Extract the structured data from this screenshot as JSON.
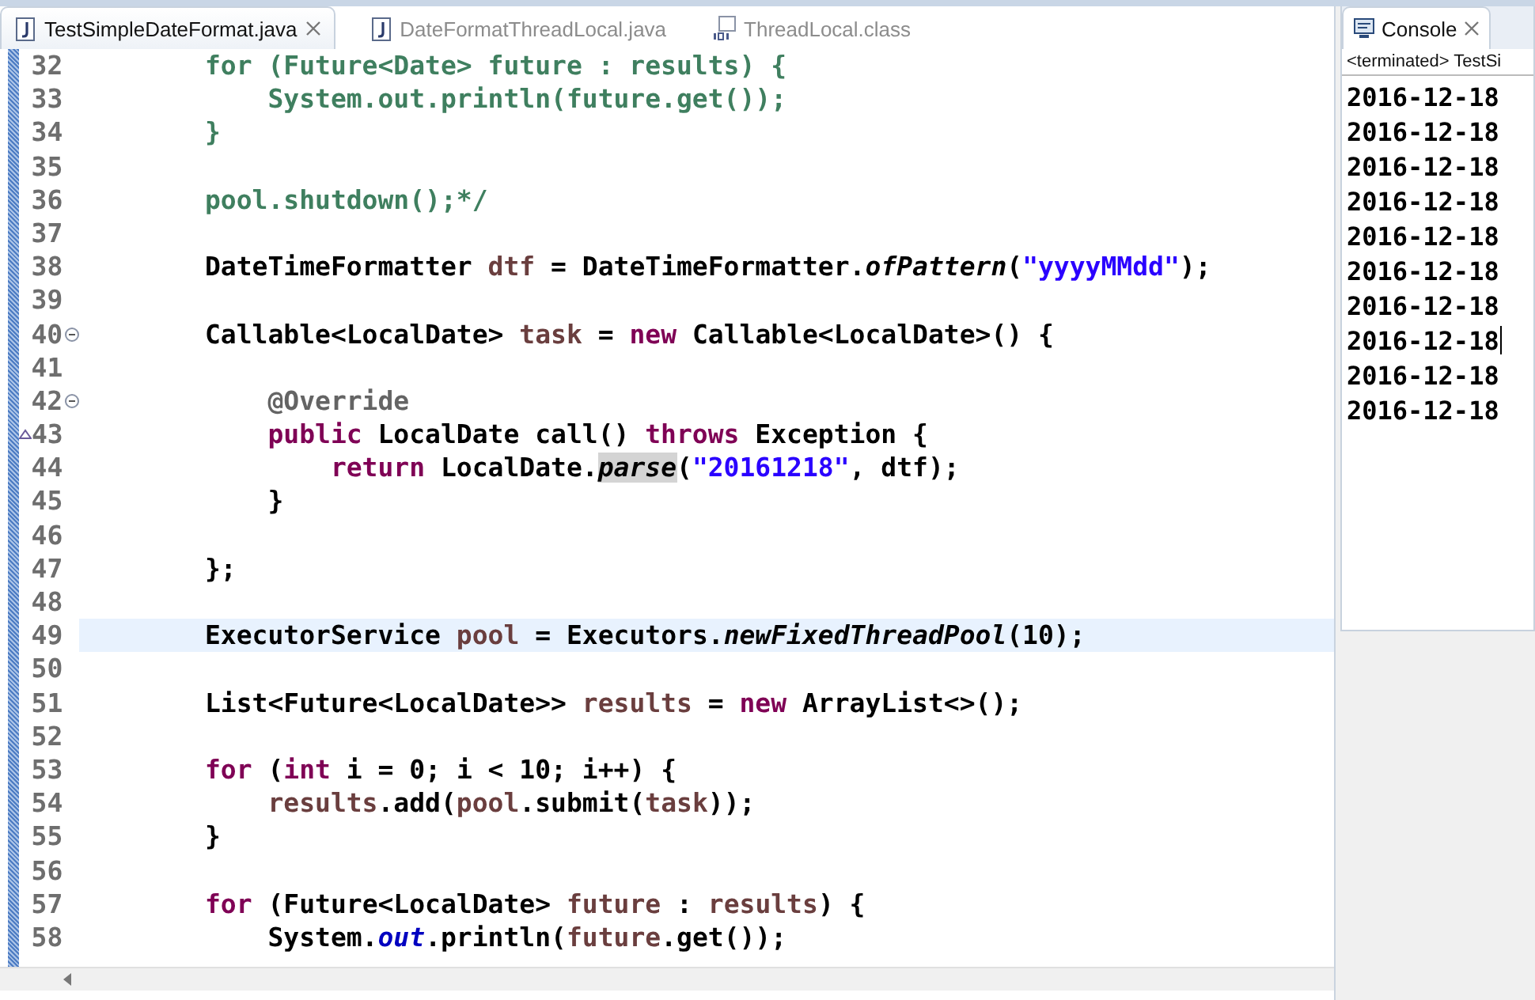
{
  "editor": {
    "tabs": [
      {
        "label": "TestSimpleDateFormat.java",
        "kind": "java",
        "selected": true,
        "closable": true
      },
      {
        "label": "DateFormatThreadLocal.java",
        "kind": "java",
        "selected": false,
        "closable": false
      },
      {
        "label": "ThreadLocal.class",
        "kind": "class",
        "selected": false,
        "closable": false
      }
    ],
    "lines": [
      {
        "num": "32",
        "kind": "code",
        "current": false,
        "tokens": [
          {
            "kind": "comment",
            "text": "        for (Future<Date> future : results) {"
          }
        ]
      },
      {
        "num": "33",
        "kind": "code",
        "current": false,
        "tokens": [
          {
            "kind": "comment",
            "text": "            System.out.println(future.get());"
          }
        ]
      },
      {
        "num": "34",
        "kind": "code",
        "current": false,
        "tokens": [
          {
            "kind": "comment",
            "text": "        }"
          }
        ]
      },
      {
        "num": "35",
        "kind": "code",
        "current": false
      },
      {
        "num": "36",
        "kind": "code",
        "current": false,
        "tokens": [
          {
            "kind": "comment",
            "text": "        pool.shutdown();*/"
          }
        ]
      },
      {
        "num": "37",
        "kind": "code",
        "current": false
      },
      {
        "num": "38",
        "kind": "code",
        "current": false,
        "tokens": [
          {
            "kind": "plain",
            "text": "        DateTimeFormatter "
          },
          {
            "kind": "variable",
            "text": "dtf"
          },
          {
            "kind": "plain",
            "text": " = DateTimeFormatter."
          },
          {
            "kind": "static",
            "text": "ofPattern"
          },
          {
            "kind": "plain",
            "text": "("
          },
          {
            "kind": "string",
            "text": "\"yyyyMMdd\""
          },
          {
            "kind": "plain",
            "text": ");"
          }
        ]
      },
      {
        "num": "39",
        "kind": "code",
        "current": false
      },
      {
        "num": "40",
        "kind": "fold",
        "current": false,
        "tokens": [
          {
            "kind": "plain",
            "text": "        Callable<LocalDate> "
          },
          {
            "kind": "variable",
            "text": "task"
          },
          {
            "kind": "plain",
            "text": " = "
          },
          {
            "kind": "keyword",
            "text": "new"
          },
          {
            "kind": "plain",
            "text": " Callable<LocalDate>() {"
          }
        ]
      },
      {
        "num": "41",
        "kind": "code",
        "current": false
      },
      {
        "num": "42",
        "kind": "fold",
        "current": false,
        "tokens": [
          {
            "kind": "annotation",
            "text": "            @Override"
          }
        ]
      },
      {
        "num": "43",
        "kind": "override",
        "current": false,
        "tokens": [
          {
            "kind": "keyword",
            "text": "            public"
          },
          {
            "kind": "plain",
            "text": " LocalDate call() "
          },
          {
            "kind": "keyword",
            "text": "throws"
          },
          {
            "kind": "plain",
            "text": " Exception {"
          }
        ]
      },
      {
        "num": "44",
        "kind": "code",
        "current": false,
        "tokens": [
          {
            "kind": "keyword",
            "text": "                return"
          },
          {
            "kind": "plain",
            "text": " LocalDate."
          },
          {
            "kind": "occurrence",
            "text": "parse"
          },
          {
            "kind": "plain",
            "text": "("
          },
          {
            "kind": "string",
            "text": "\"20161218\""
          },
          {
            "kind": "plain",
            "text": ", dtf);"
          }
        ]
      },
      {
        "num": "45",
        "kind": "code",
        "current": false,
        "tokens": [
          {
            "kind": "plain",
            "text": "            }"
          }
        ]
      },
      {
        "num": "46",
        "kind": "code",
        "current": false
      },
      {
        "num": "47",
        "kind": "code",
        "current": false,
        "tokens": [
          {
            "kind": "plain",
            "text": "        };"
          }
        ]
      },
      {
        "num": "48",
        "kind": "code",
        "current": false
      },
      {
        "num": "49",
        "kind": "code",
        "current": true,
        "tokens": [
          {
            "kind": "plain",
            "text": "        ExecutorService "
          },
          {
            "kind": "variable",
            "text": "pool"
          },
          {
            "kind": "plain",
            "text": " = Executors."
          },
          {
            "kind": "static",
            "text": "newFixedThreadPool"
          },
          {
            "kind": "plain",
            "text": "(10);"
          }
        ]
      },
      {
        "num": "50",
        "kind": "code",
        "current": false
      },
      {
        "num": "51",
        "kind": "code",
        "current": false,
        "tokens": [
          {
            "kind": "plain",
            "text": "        List<Future<LocalDate>> "
          },
          {
            "kind": "variable",
            "text": "results"
          },
          {
            "kind": "plain",
            "text": " = "
          },
          {
            "kind": "keyword",
            "text": "new"
          },
          {
            "kind": "plain",
            "text": " ArrayList<>();"
          }
        ]
      },
      {
        "num": "52",
        "kind": "code",
        "current": false
      },
      {
        "num": "53",
        "kind": "code",
        "current": false,
        "tokens": [
          {
            "kind": "keyword",
            "text": "        for"
          },
          {
            "kind": "plain",
            "text": " ("
          },
          {
            "kind": "keyword",
            "text": "int"
          },
          {
            "kind": "plain",
            "text": " i = 0; i < 10; i++) {"
          }
        ]
      },
      {
        "num": "54",
        "kind": "code",
        "current": false,
        "tokens": [
          {
            "kind": "variable",
            "text": "            results"
          },
          {
            "kind": "plain",
            "text": ".add("
          },
          {
            "kind": "variable",
            "text": "pool"
          },
          {
            "kind": "plain",
            "text": ".submit("
          },
          {
            "kind": "variable",
            "text": "task"
          },
          {
            "kind": "plain",
            "text": "));"
          }
        ]
      },
      {
        "num": "55",
        "kind": "code",
        "current": false,
        "tokens": [
          {
            "kind": "plain",
            "text": "        }"
          }
        ]
      },
      {
        "num": "56",
        "kind": "code",
        "current": false
      },
      {
        "num": "57",
        "kind": "code",
        "current": false,
        "tokens": [
          {
            "kind": "keyword",
            "text": "        for"
          },
          {
            "kind": "plain",
            "text": " (Future<LocalDate> "
          },
          {
            "kind": "variable",
            "text": "future"
          },
          {
            "kind": "plain",
            "text": " : "
          },
          {
            "kind": "variable",
            "text": "results"
          },
          {
            "kind": "plain",
            "text": ") {"
          }
        ]
      },
      {
        "num": "58",
        "kind": "code",
        "current": false,
        "tokens": [
          {
            "kind": "plain",
            "text": "            System."
          },
          {
            "kind": "field",
            "text": "out"
          },
          {
            "kind": "plain",
            "text": ".println("
          },
          {
            "kind": "variable",
            "text": "future"
          },
          {
            "kind": "plain",
            "text": ".get());"
          }
        ]
      }
    ]
  },
  "console": {
    "tab": {
      "label": "Console",
      "selected": true
    },
    "status": "<terminated> TestSi",
    "output": [
      {
        "text": "2016-12-18",
        "caret": false
      },
      {
        "text": "2016-12-18",
        "caret": false
      },
      {
        "text": "2016-12-18",
        "caret": false
      },
      {
        "text": "2016-12-18",
        "caret": false
      },
      {
        "text": "2016-12-18",
        "caret": false
      },
      {
        "text": "2016-12-18",
        "caret": false
      },
      {
        "text": "2016-12-18",
        "caret": false
      },
      {
        "text": "2016-12-18",
        "caret": true
      },
      {
        "text": "2016-12-18",
        "caret": false
      },
      {
        "text": "2016-12-18",
        "caret": false
      }
    ]
  }
}
